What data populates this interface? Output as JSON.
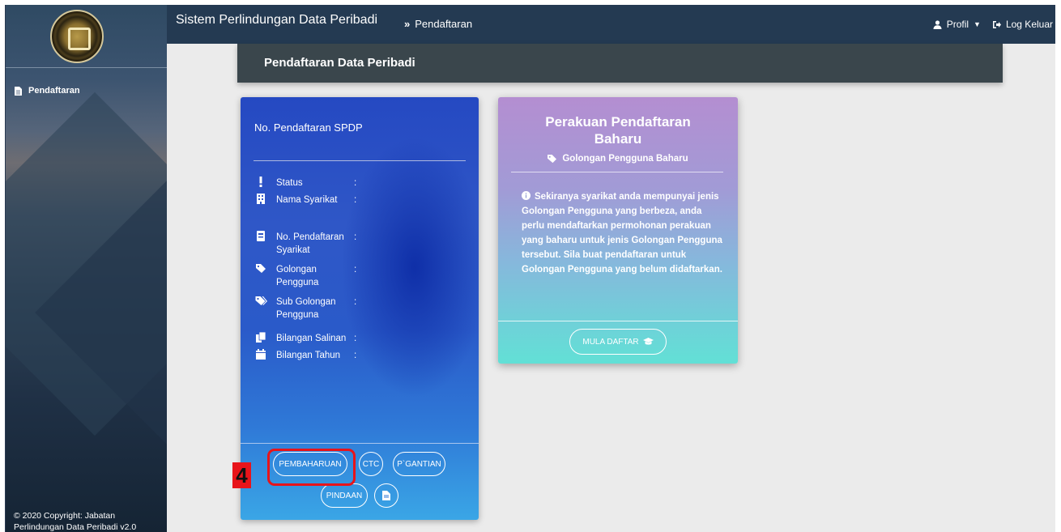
{
  "app": {
    "title": "Sistem Perlindungan Data Peribadi"
  },
  "breadcrumb": {
    "current": "Pendaftaran"
  },
  "topnav": {
    "profile_label": "Profil",
    "logout_label": "Log Keluar"
  },
  "sidebar": {
    "items": [
      {
        "label": "Pendaftaran",
        "icon": "file-icon"
      }
    ],
    "copyright_line1": "© 2020 Copyright: Jabatan",
    "copyright_line2": "Perlindungan Data Peribadi v2.0"
  },
  "page": {
    "header": "Pendaftaran Data Peribadi"
  },
  "registration_card": {
    "heading": "No. Pendaftaran SPDP",
    "fields": [
      {
        "label": "Status",
        "icon": "exclamation-icon",
        "value": ":"
      },
      {
        "label": "Nama Syarikat",
        "icon": "building-icon",
        "value": ":"
      },
      {
        "label": "No. Pendaftaran Syarikat",
        "icon": "id-card-icon",
        "value": ":"
      },
      {
        "label": "Golongan Pengguna",
        "icon": "tag-icon",
        "value": ":"
      },
      {
        "label": "Sub Golongan Pengguna",
        "icon": "tags-icon",
        "value": ":"
      },
      {
        "label": "Bilangan Salinan",
        "icon": "copy-icon",
        "value": ":"
      },
      {
        "label": "Bilangan Tahun",
        "icon": "calendar-icon",
        "value": ":"
      }
    ],
    "buttons": {
      "pembaharuan": "PEMBAHARUAN",
      "ctc": "CTC",
      "pgantian": "P`GANTIAN",
      "pindaan": "PINDAAN"
    }
  },
  "new_registration_card": {
    "title_line1": "Perakuan Pendaftaran",
    "title_line2": "Baharu",
    "subtitle": "Golongan Pengguna Baharu",
    "description": "Sekiranya syarikat anda mempunyai jenis Golongan Pengguna yang berbeza, anda perlu mendaftarkan permohonan perakuan yang baharu untuk jenis Golongan Pengguna tersebut. Sila buat pendaftaran untuk Golongan Pengguna yang belum didaftarkan.",
    "button_label": "MULA DAFTAR"
  },
  "annotation": {
    "step_number": "4"
  },
  "colors": {
    "topbar": "#243a52",
    "header_bar": "#3a464c",
    "highlight": "#e8141a"
  }
}
